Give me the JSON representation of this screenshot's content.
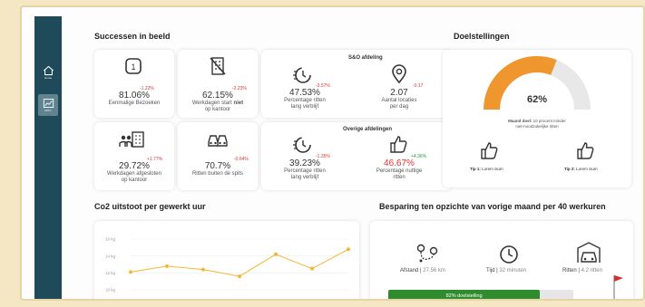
{
  "sidebar": {
    "items": [
      {
        "label": "Home",
        "icon": "home-icon"
      },
      {
        "label": "KPI's",
        "icon": "chart-icon"
      }
    ]
  },
  "sections": {
    "successes": "Successen in beeld",
    "goals": "Doelstellingen",
    "co2": "Co2 uitstoot per gewerkt uur",
    "savings": "Besparing ten opzichte van vorige maand per 40 werkuren"
  },
  "kpis": {
    "single_visits": {
      "value": "81.06%",
      "label": "Eenmalige Bezoeken",
      "delta": "-1.22%"
    },
    "no_office_days": {
      "value": "62.15%",
      "label_a": "Werkdagen start ",
      "label_b": "niet",
      "label_c": "op kantoor",
      "delta": "-2.23%"
    },
    "closed_days": {
      "value": "29.72%",
      "label_a": "Werkdagen afgesloten",
      "label_b": "op kantoor",
      "delta": "+1.77%"
    },
    "off_peak": {
      "value": "70.7%",
      "label": "Ritten buiten de spits",
      "delta": "-0.64%"
    }
  },
  "sno": {
    "title": "S&O afdeling",
    "long_stay": {
      "value": "47.53%",
      "label_a": "Percentage ritten",
      "label_b": "lang verblijf",
      "delta": "-3.57%"
    },
    "locations": {
      "value": "2.07",
      "label_a": "Aantal locaties",
      "label_b": "per dag",
      "delta": "-0.17"
    }
  },
  "other": {
    "title": "Overige afdelingen",
    "long_stay": {
      "value": "39.23%",
      "label_a": "Percentage ritten",
      "label_b": "lang verblijf",
      "delta": "-1.35%"
    },
    "useful": {
      "value": "46.67%",
      "label_a": "Percentage nuttige",
      "label_b": "ritten",
      "delta": "+4.36%"
    }
  },
  "goals": {
    "gauge_value": "62%",
    "gauge_fraction": 0.62,
    "goal_line1": "Maand doel: 10 procent minder",
    "goal_line2": "niet-noodzakelijke ritten",
    "goal_bold": "Maand doel:",
    "tip1_bold": "Tip 1:",
    "tip1_text": " Lorem isum",
    "tip2_bold": "Tip 2:",
    "tip2_text": " Lorem isum",
    "accent": "#f0962e"
  },
  "chart_data": {
    "type": "line",
    "title": "Co2 uitstoot per gewerkt uur",
    "yticks": [
      "16 kg",
      "14 kg",
      "12 kg",
      "10 kg"
    ],
    "ylim": [
      10,
      16
    ],
    "x": [
      1,
      2,
      3,
      4,
      5,
      6,
      7
    ],
    "values": [
      12.1,
      12.8,
      12.4,
      11.6,
      14.2,
      12.5,
      14.8
    ],
    "color": "#f5b731",
    "grid": true
  },
  "savings": {
    "distance_label": "Afstand | ",
    "distance_value": "27.56 km",
    "time_label": "Tijd | ",
    "time_value": "32 minuten",
    "rides_label": "Ritten | ",
    "rides_value": "4.2 ritten",
    "progress_label": "82% doelstelling",
    "progress_fraction": 0.82
  }
}
